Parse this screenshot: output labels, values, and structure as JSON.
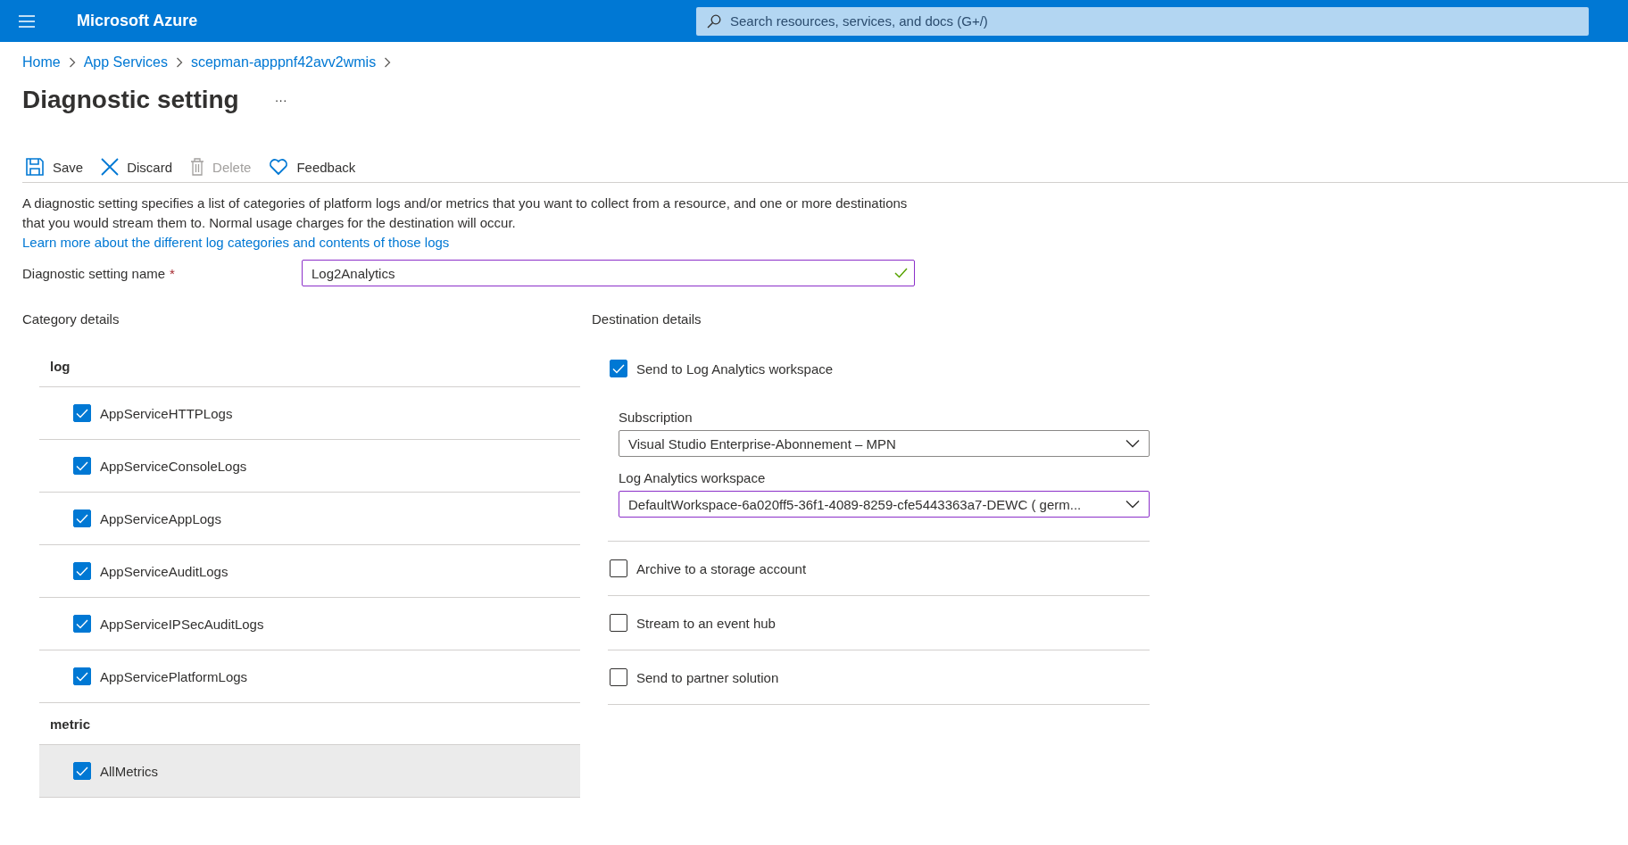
{
  "header": {
    "brand": "Microsoft Azure",
    "search": {
      "placeholder": "Search resources, services, and docs (G+/)"
    }
  },
  "breadcrumb": [
    "Home",
    "App Services",
    "scepman-apppnf42avv2wmis"
  ],
  "title": "Diagnostic setting",
  "more": "···",
  "toolbar": [
    {
      "kind": "save",
      "label": "Save",
      "disabled": false
    },
    {
      "kind": "discard",
      "label": "Discard",
      "disabled": false
    },
    {
      "kind": "delete",
      "label": "Delete",
      "disabled": true
    },
    {
      "kind": "feedback",
      "label": "Feedback",
      "disabled": false
    }
  ],
  "description": {
    "text": "A diagnostic setting specifies a list of categories of platform logs and/or metrics that you want to collect from a resource, and one or more destinations that you would stream them to. Normal usage charges for the destination will occur.",
    "link": "Learn more about the different log categories and contents of those logs"
  },
  "name_field": {
    "label": "Diagnostic setting name",
    "required_marker": "*",
    "value": "Log2Analytics",
    "valid": true,
    "focused": true
  },
  "category_details": {
    "title": "Category details",
    "groups": [
      {
        "name": "log",
        "items": [
          {
            "label": "AppServiceHTTPLogs",
            "checked": true,
            "selected": false
          },
          {
            "label": "AppServiceConsoleLogs",
            "checked": true,
            "selected": false
          },
          {
            "label": "AppServiceAppLogs",
            "checked": true,
            "selected": false
          },
          {
            "label": "AppServiceAuditLogs",
            "checked": true,
            "selected": false
          },
          {
            "label": "AppServiceIPSecAuditLogs",
            "checked": true,
            "selected": false
          },
          {
            "label": "AppServicePlatformLogs",
            "checked": true,
            "selected": false
          }
        ]
      },
      {
        "name": "metric",
        "items": [
          {
            "label": "AllMetrics",
            "checked": true,
            "selected": true
          }
        ]
      }
    ]
  },
  "destination_details": {
    "title": "Destination details",
    "destinations": [
      {
        "label": "Send to Log Analytics workspace",
        "checked": true,
        "dropdowns": [
          {
            "label": "Subscription",
            "value": "Visual Studio Enterprise-Abonnement – MPN",
            "focused": false
          },
          {
            "label": "Log Analytics workspace",
            "value": "DefaultWorkspace-6a020ff5-36f1-4089-8259-cfe5443363a7-DEWC ( germ...",
            "focused": true
          }
        ]
      },
      {
        "label": "Archive to a storage account",
        "checked": false
      },
      {
        "label": "Stream to an event hub",
        "checked": false
      },
      {
        "label": "Send to partner solution",
        "checked": false
      }
    ]
  }
}
